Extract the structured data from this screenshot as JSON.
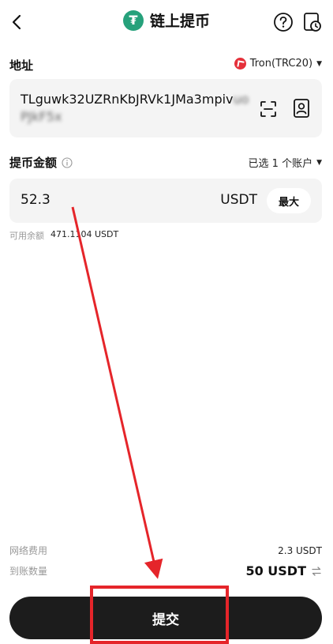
{
  "header": {
    "title": "链上提币",
    "token_icon": "tether-icon",
    "token_symbol": "₮",
    "icons": [
      "back-icon",
      "help-icon",
      "history-icon"
    ]
  },
  "address_section": {
    "label": "地址",
    "network": "Tron(TRC20)",
    "address_visible": "TLguwk32UZRnKbJRVk1JMa3mpiv",
    "address_masked": "uoPJkF5x",
    "icons": [
      "scan-icon",
      "address-book-icon"
    ]
  },
  "amount_section": {
    "label": "提币金额",
    "account_selector": "已选 1 个账户",
    "value": "52.3",
    "unit": "USDT",
    "max_label": "最大",
    "balance_label": "可用余额",
    "balance_value": "471.1104 USDT"
  },
  "summary": {
    "fee_label": "网络费用",
    "fee_value": "2.3 USDT",
    "receive_label": "到账数量",
    "receive_value": "50 USDT"
  },
  "submit_label": "提交",
  "colors": {
    "tether": "#26a17b",
    "tron": "#e5303a",
    "submit_bg": "#1c1c1c",
    "annotation": "#e5252a"
  }
}
